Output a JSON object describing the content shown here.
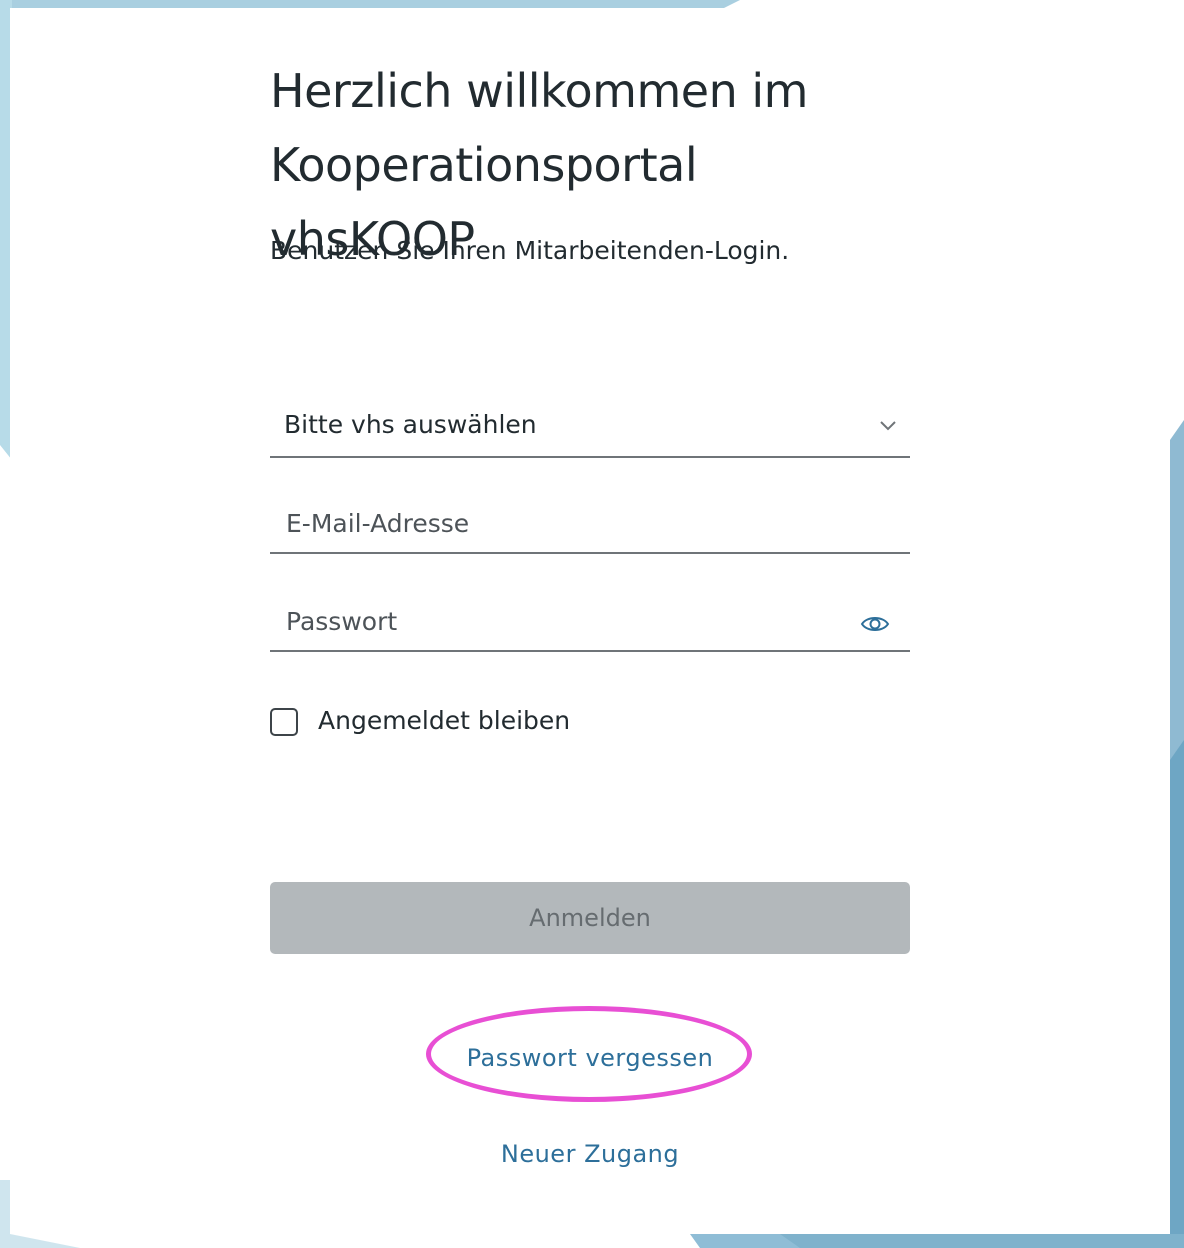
{
  "header": {
    "title_line1": "Herzlich willkommen im",
    "title_line2": "Kooperationsportal vhsKOOP",
    "subtitle": "Benutzen Sie Ihren Mitarbeitenden-Login."
  },
  "form": {
    "vhs_select_value": "Bitte vhs auswählen",
    "email_placeholder": "E-Mail-Adresse",
    "password_placeholder": "Passwort",
    "remember_label": "Angemeldet bleiben",
    "remember_checked": false,
    "login_button_label": "Anmelden"
  },
  "links": {
    "forgot_password": "Passwort vergessen",
    "new_account": "Neuer Zugang"
  },
  "icons": {
    "select": "chevron-down-icon",
    "password_toggle": "eye-icon"
  },
  "colors": {
    "text": "#222b30",
    "link": "#2d6f9a",
    "button_disabled": "#b3b8bb",
    "highlight": "#e84fd4",
    "background_accent": "#9cc7da"
  }
}
